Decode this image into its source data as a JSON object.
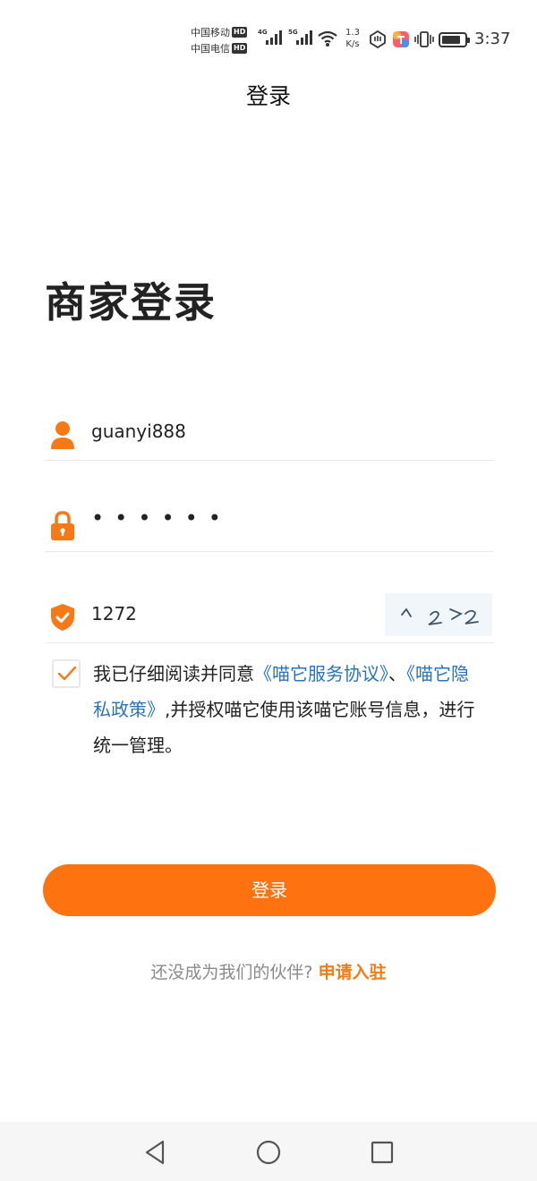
{
  "status_bar": {
    "carrier1": "中国移动",
    "carrier2": "中国电信",
    "hd": "HD",
    "net1": "4G",
    "net2": "5G",
    "speed_value": "1.3",
    "speed_unit": "K/s",
    "battery_level": 0.85,
    "time": "3:37"
  },
  "nav": {
    "title": "登录"
  },
  "heading": "商家登录",
  "form": {
    "username": "guanyi888",
    "password_mask": "••••••",
    "captcha_input": "1272",
    "captcha_image_text": "1272"
  },
  "agreement": {
    "checked": true,
    "prefix": "我已仔细阅读并同意",
    "service_link": "《喵它服务协议》",
    "separator": "、",
    "privacy_link": "《喵它隐私政策》",
    "suffix": ",并授权喵它使用该喵它账号信息，进行统一管理。"
  },
  "login_button": "登录",
  "register": {
    "prompt": "还没成为我们的伙伴?",
    "link": "申请入驻"
  },
  "colors": {
    "accent": "#ff7210",
    "link": "#2a73b8",
    "apply": "#f07c16"
  }
}
